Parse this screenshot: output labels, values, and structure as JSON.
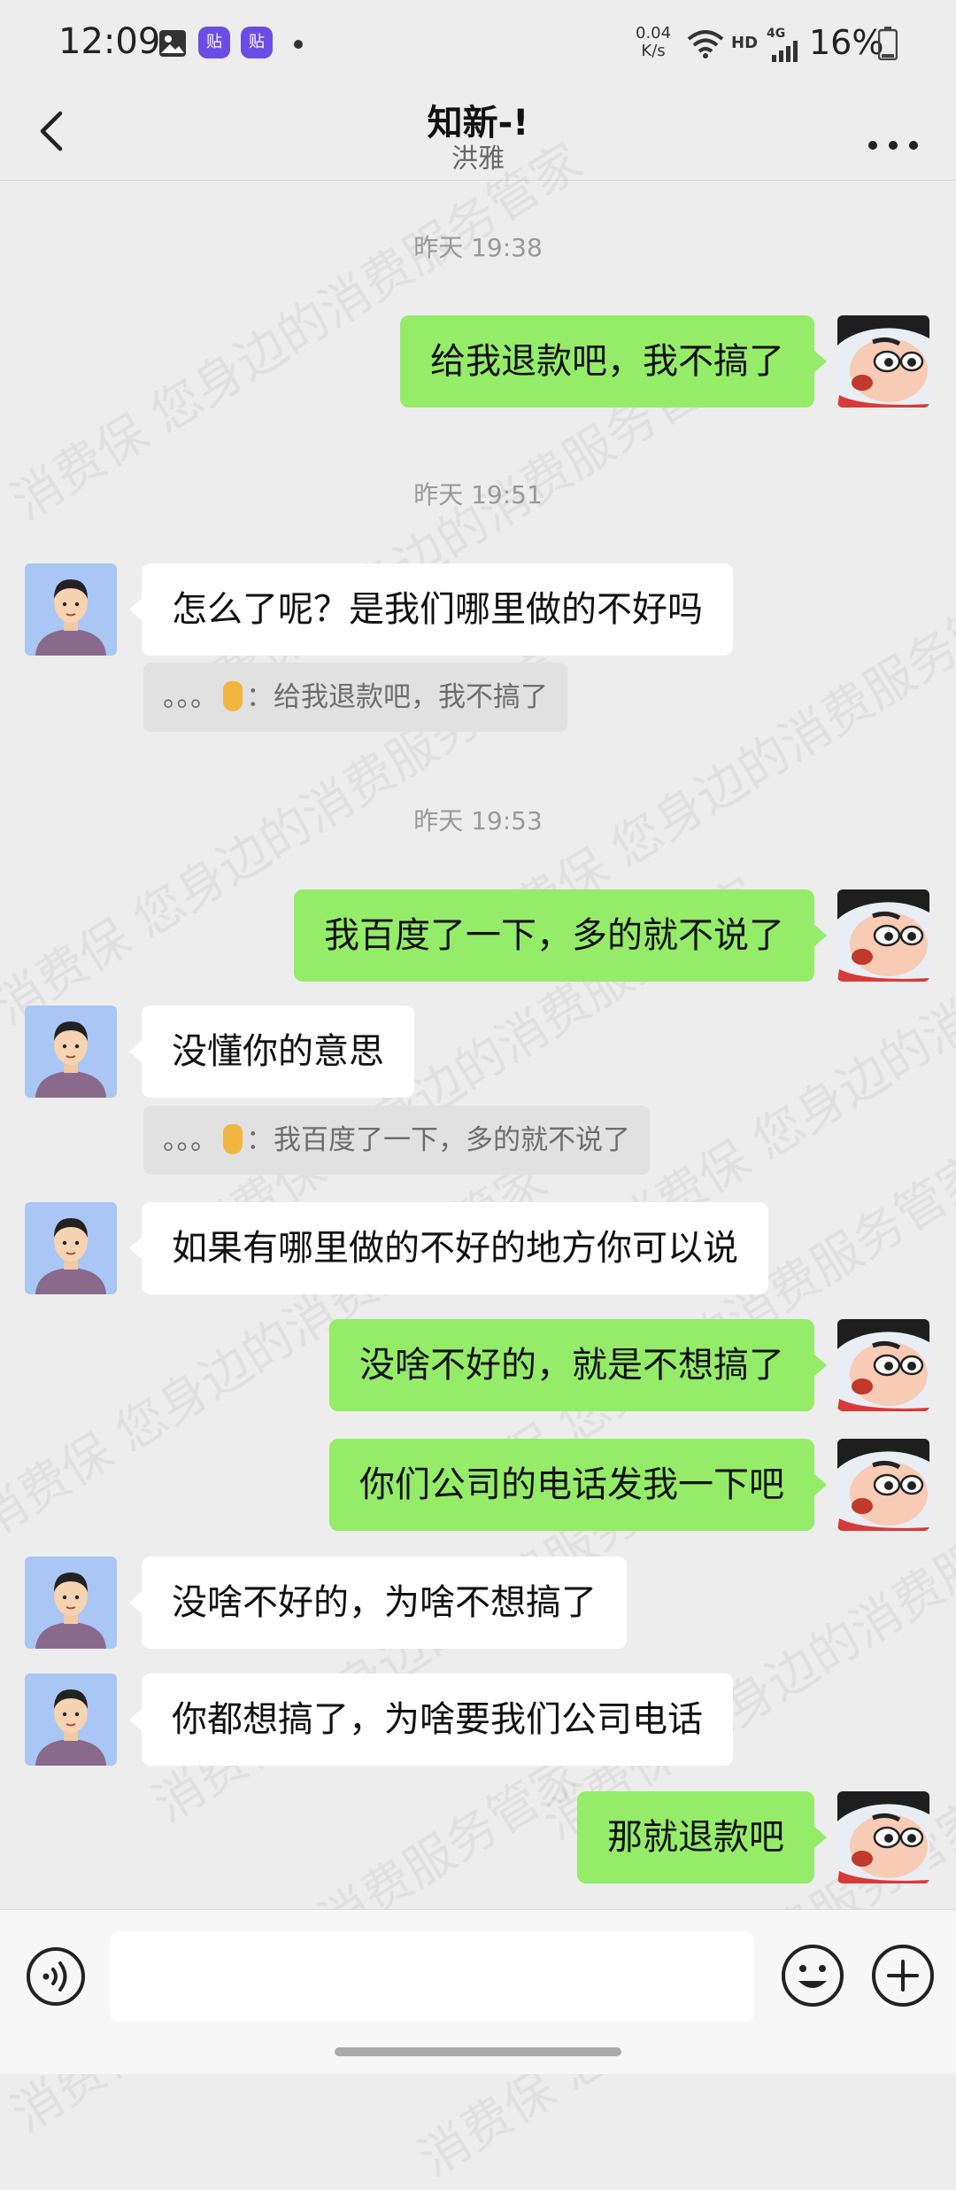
{
  "status_bar": {
    "time": "12:09",
    "notif_label": "贴",
    "network_speed_value": "0.04",
    "network_speed_unit": "K/s",
    "hd": "HD",
    "signal": "4G",
    "battery": "16%"
  },
  "header": {
    "title": "知新-!",
    "subtitle": "洪雅"
  },
  "watermark_text": "消费保 您身边的消费服务管家",
  "messages": [
    {
      "kind": "time",
      "text": "昨天 19:38"
    },
    {
      "kind": "right",
      "text": "给我退款吧，我不搞了"
    },
    {
      "kind": "time",
      "text": "昨天 19:51"
    },
    {
      "kind": "left",
      "text": "怎么了呢？是我们哪里做的不好吗"
    },
    {
      "kind": "quote",
      "prefix": "。。。",
      "suffix": "：给我退款吧，我不搞了"
    },
    {
      "kind": "time",
      "text": "昨天 19:53"
    },
    {
      "kind": "right",
      "text": "我百度了一下，多的就不说了"
    },
    {
      "kind": "left",
      "text": "没懂你的意思"
    },
    {
      "kind": "quote",
      "prefix": "。。。",
      "suffix": "：我百度了一下，多的就不说了"
    },
    {
      "kind": "left",
      "text": "如果有哪里做的不好的地方你可以说"
    },
    {
      "kind": "right",
      "text": "没啥不好的，就是不想搞了"
    },
    {
      "kind": "right",
      "text": "你们公司的电话发我一下吧"
    },
    {
      "kind": "left",
      "text": "没啥不好的，为啥不想搞了"
    },
    {
      "kind": "left",
      "text": "你都想搞了，为啥要我们公司电话"
    },
    {
      "kind": "right",
      "text": "那就退款吧"
    }
  ],
  "input": {
    "value": "",
    "placeholder": ""
  },
  "icons": {
    "back": "chevron-left-icon",
    "more": "more-dots-icon",
    "voice": "voice-icon",
    "emoji": "emoji-icon",
    "plus": "plus-icon"
  },
  "colors": {
    "background": "#ededed",
    "my_bubble": "#95ec69",
    "their_bubble": "#ffffff",
    "quote_bg": "#e1e1e1",
    "timestamp": "#999999"
  }
}
